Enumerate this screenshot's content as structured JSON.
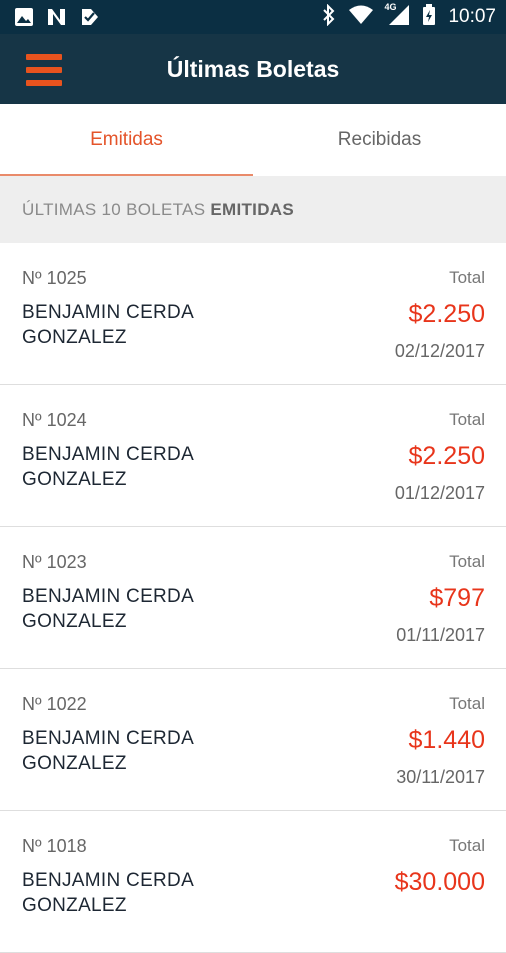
{
  "status_bar": {
    "time": "10:07",
    "network": "4G",
    "icons_left": [
      "image-icon",
      "n-notification-icon",
      "check-notification-icon"
    ],
    "icons_right": [
      "bluetooth-icon",
      "wifi-icon",
      "cell-signal-icon",
      "battery-icon"
    ]
  },
  "app_bar": {
    "title": "Últimas Boletas",
    "menu_icon": "hamburger-menu-icon"
  },
  "tabs": [
    {
      "label": "Emitidas",
      "active": true
    },
    {
      "label": "Recibidas",
      "active": false
    }
  ],
  "section_header": {
    "prefix": "ÚLTIMAS 10 BOLETAS ",
    "emphasis": "EMITIDAS"
  },
  "boletas": [
    {
      "number": "Nº 1025",
      "name": "BENJAMIN  CERDA GONZALEZ",
      "total_label": "Total",
      "amount": "$2.250",
      "date": "02/12/2017"
    },
    {
      "number": "Nº 1024",
      "name": "BENJAMIN  CERDA GONZALEZ",
      "total_label": "Total",
      "amount": "$2.250",
      "date": "01/12/2017"
    },
    {
      "number": "Nº 1023",
      "name": "BENJAMIN  CERDA GONZALEZ",
      "total_label": "Total",
      "amount": "$797",
      "date": "01/11/2017"
    },
    {
      "number": "Nº 1022",
      "name": "BENJAMIN  CERDA GONZALEZ",
      "total_label": "Total",
      "amount": "$1.440",
      "date": "30/11/2017"
    },
    {
      "number": "Nº 1018",
      "name": "BENJAMIN CERDA GONZALEZ",
      "total_label": "Total",
      "amount": "$30.000",
      "date": ""
    }
  ],
  "colors": {
    "status_bar": "#0b2f43",
    "app_bar": "#163546",
    "accent": "#e8531e",
    "amount": "#e8351b",
    "active_tab": "#e4542a",
    "section_bg": "#eeeeee"
  }
}
